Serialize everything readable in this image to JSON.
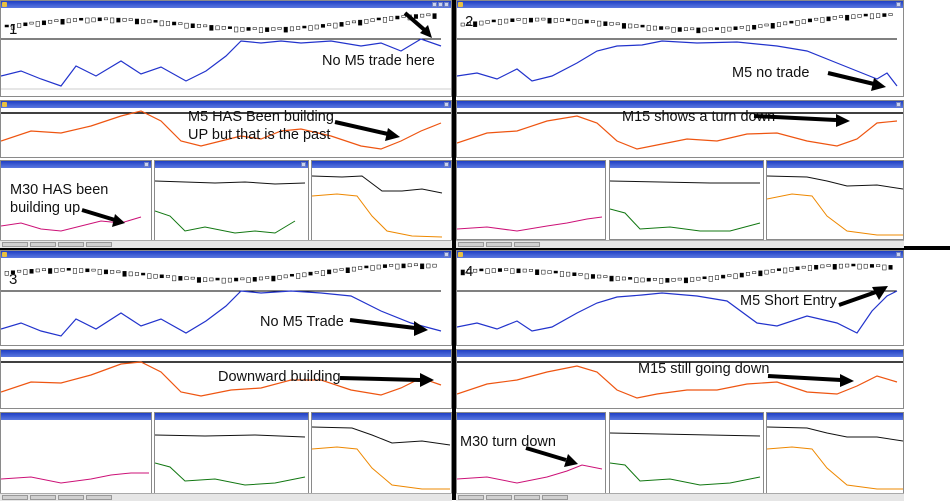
{
  "quadrants": [
    {
      "number": "1",
      "notes": [
        "No M5 trade here",
        "M5 HAS Been building\nUP but that is the past",
        "M30 HAS been\nbuilding up"
      ]
    },
    {
      "number": "2",
      "notes": [
        "M5 no trade",
        "M15 shows a turn down"
      ]
    },
    {
      "number": "3",
      "notes": [
        "No M5 Trade",
        "Downward building"
      ]
    },
    {
      "number": "4",
      "notes": [
        "M5 Short Entry",
        "M15 still going down",
        "M30 turn down"
      ]
    }
  ],
  "colors": {
    "price": "#000000",
    "m5": "#2233cc",
    "m15": "#ee5511",
    "m30": "#cc1177",
    "green": "#117711",
    "orange": "#ee8800",
    "titlebar": "#1f3fc4",
    "arrow": "#000000"
  }
}
